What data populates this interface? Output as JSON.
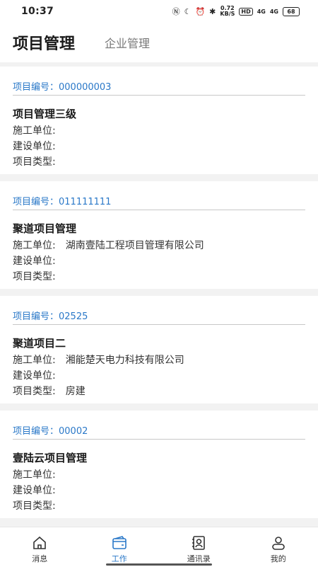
{
  "status_bar": {
    "time": "10:37",
    "icons": [
      "nfc-icon",
      "moon-icon",
      "alarm-icon",
      "bluetooth-icon"
    ],
    "speed": "0.72\nKB/S",
    "hd": "HD",
    "signal1": "4G",
    "signal2": "4G",
    "battery": "68"
  },
  "header": {
    "tab_active": "项目管理",
    "tab_inactive": "企业管理"
  },
  "projects": [
    {
      "id_label": "项目编号：000000003",
      "name": "项目管理三级",
      "construction_label": "施工单位:",
      "construction_value": "",
      "builder_label": "建设单位:",
      "builder_value": "",
      "type_label": "项目类型:",
      "type_value": ""
    },
    {
      "id_label": "项目编号：011111111",
      "name": "聚道项目管理",
      "construction_label": "施工单位:",
      "construction_value": "湖南壹陆工程项目管理有限公司",
      "builder_label": "建设单位:",
      "builder_value": "",
      "type_label": "项目类型:",
      "type_value": ""
    },
    {
      "id_label": "项目编号：02525",
      "name": "聚道项目二",
      "construction_label": "施工单位:",
      "construction_value": "湘能楚天电力科技有限公司",
      "builder_label": "建设单位:",
      "builder_value": "",
      "type_label": "项目类型:",
      "type_value": "房建"
    },
    {
      "id_label": "项目编号：00002",
      "name": "壹陆云项目管理",
      "construction_label": "施工单位:",
      "construction_value": "",
      "builder_label": "建设单位:",
      "builder_value": "",
      "type_label": "项目类型:",
      "type_value": ""
    }
  ],
  "bottom_nav": {
    "items": [
      {
        "label": "消息",
        "icon": "home-icon"
      },
      {
        "label": "工作",
        "icon": "wallet-icon"
      },
      {
        "label": "通讯录",
        "icon": "contacts-icon"
      },
      {
        "label": "我的",
        "icon": "user-icon"
      }
    ],
    "active_color": "#2a78c8"
  }
}
